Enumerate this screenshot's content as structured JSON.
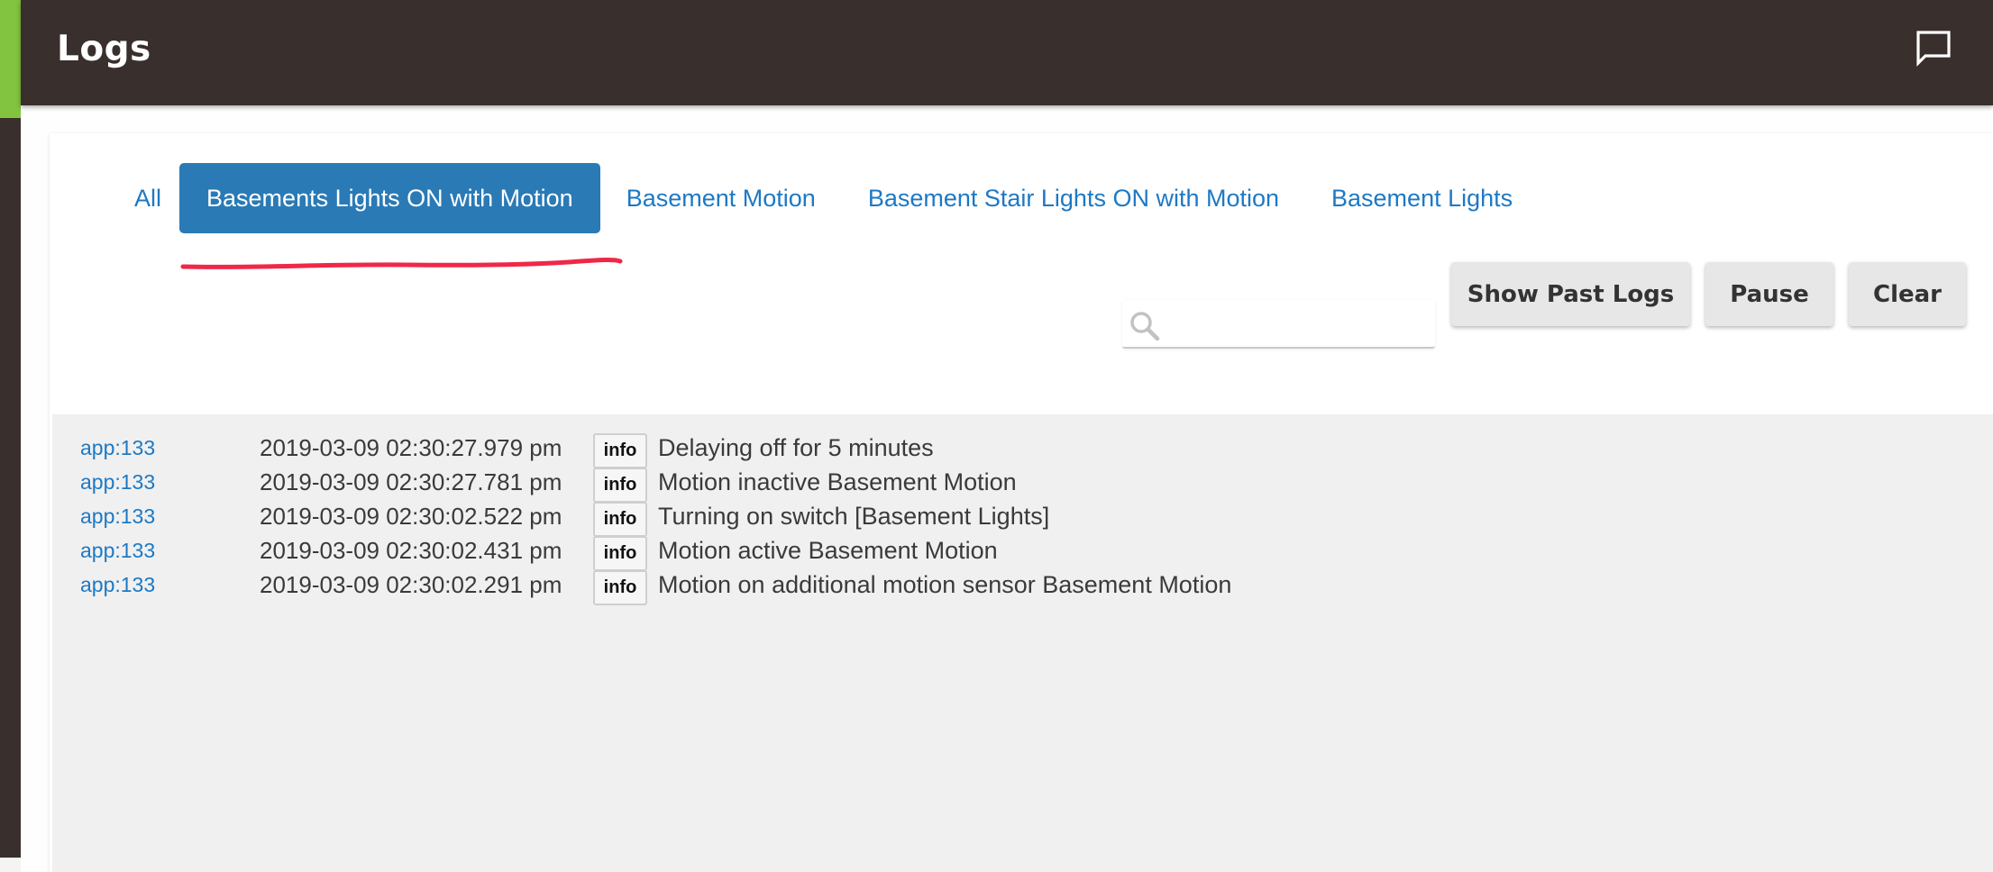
{
  "header": {
    "title": "Logs",
    "chat_icon": "chat-bubble-icon"
  },
  "tabs": [
    {
      "label": "All",
      "active": false
    },
    {
      "label": "Basements Lights ON with Motion",
      "active": true
    },
    {
      "label": "Basement Motion",
      "active": false
    },
    {
      "label": "Basement Stair Lights ON with Motion",
      "active": false
    },
    {
      "label": "Basement Lights",
      "active": false
    }
  ],
  "search": {
    "value": "",
    "placeholder": "",
    "icon": "search-icon"
  },
  "buttons": {
    "show_past_logs": "Show Past Logs",
    "pause": "Pause",
    "clear": "Clear"
  },
  "logs": [
    {
      "source": "app:133",
      "time": "2019-03-09 02:30:27.979 pm",
      "level": "info",
      "message": "Delaying off for 5 minutes"
    },
    {
      "source": "app:133",
      "time": "2019-03-09 02:30:27.781 pm",
      "level": "info",
      "message": "Motion inactive Basement Motion"
    },
    {
      "source": "app:133",
      "time": "2019-03-09 02:30:02.522 pm",
      "level": "info",
      "message": "Turning on switch [Basement Lights]"
    },
    {
      "source": "app:133",
      "time": "2019-03-09 02:30:02.431 pm",
      "level": "info",
      "message": "Motion active Basement Motion"
    },
    {
      "source": "app:133",
      "time": "2019-03-09 02:30:02.291 pm",
      "level": "info",
      "message": "Motion on additional motion sensor Basement Motion"
    }
  ],
  "colors": {
    "header_bg": "#392f2d",
    "accent_green": "#82c43f",
    "active_tab_bg": "#2a7ab5",
    "link_blue": "#1d79c4",
    "annotation_red": "#f02848"
  }
}
